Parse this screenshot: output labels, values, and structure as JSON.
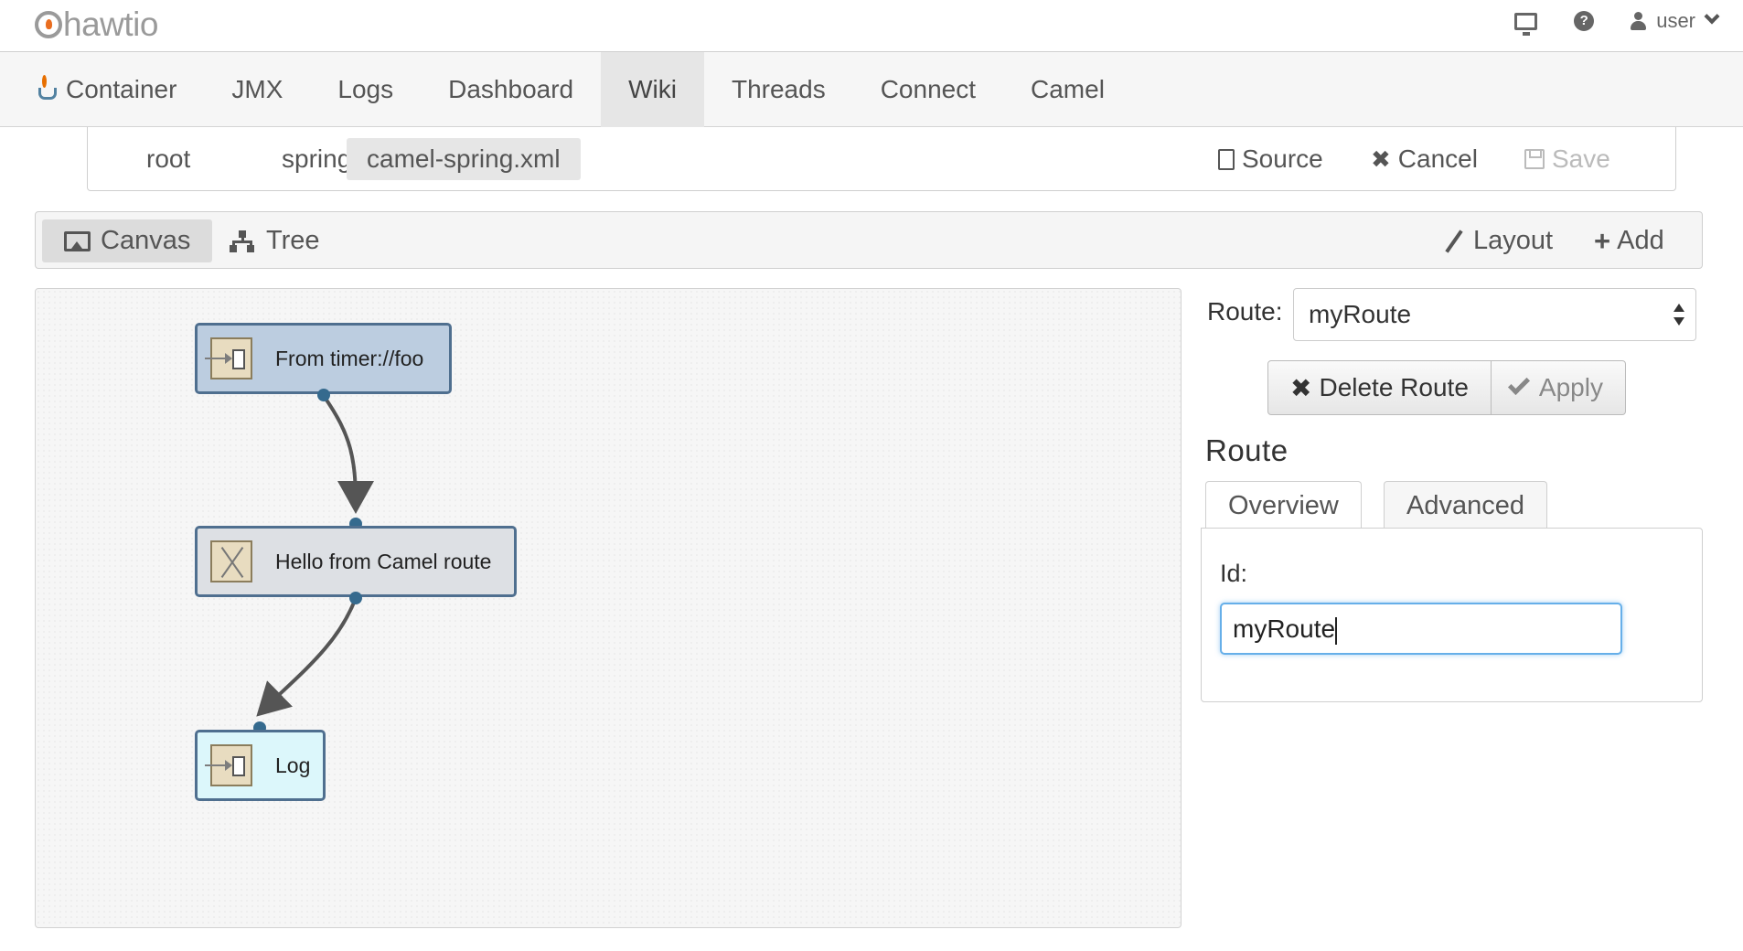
{
  "app": {
    "logo_text": "hawtio",
    "user_label": "user"
  },
  "nav": {
    "items": [
      {
        "label": "Container"
      },
      {
        "label": "JMX"
      },
      {
        "label": "Logs"
      },
      {
        "label": "Dashboard"
      },
      {
        "label": "Wiki",
        "active": true
      },
      {
        "label": "Threads"
      },
      {
        "label": "Connect"
      },
      {
        "label": "Camel"
      }
    ]
  },
  "breadcrumb": {
    "items": [
      "root",
      "spring",
      "camel-spring.xml"
    ],
    "active": "camel-spring.xml"
  },
  "file_actions": {
    "source": "Source",
    "cancel": "Cancel",
    "save": "Save"
  },
  "toolbar": {
    "canvas": "Canvas",
    "tree": "Tree",
    "layout": "Layout",
    "add": "Add",
    "active_view": "Canvas"
  },
  "diagram": {
    "nodes": [
      {
        "label": "From timer://foo",
        "kind": "from"
      },
      {
        "label": "Hello from Camel route",
        "kind": "processor"
      },
      {
        "label": "Log",
        "kind": "log"
      }
    ]
  },
  "route_form": {
    "route_label": "Route:",
    "route_value": "myRoute",
    "delete_label": "Delete Route",
    "apply_label": "Apply",
    "section_title": "Route",
    "tabs": [
      "Overview",
      "Advanced"
    ],
    "active_tab": "Overview",
    "id_label": "Id:",
    "id_value": "myRoute"
  },
  "colors": {
    "from_node": "#bccde0",
    "processor_node": "#dde0e4",
    "log_node": "#dcf7fb",
    "node_border": "#4f6f8f",
    "focus": "#66afe9"
  }
}
